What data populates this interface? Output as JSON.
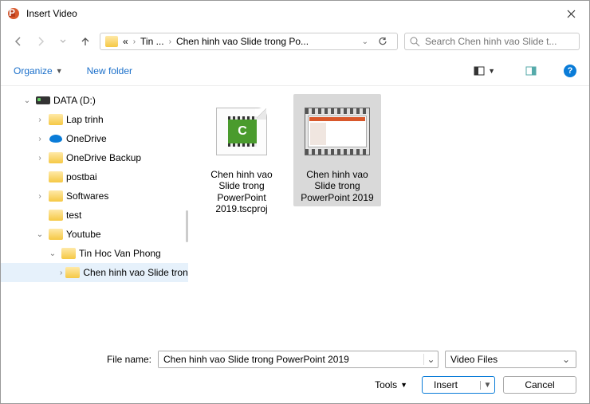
{
  "window": {
    "title": "Insert Video"
  },
  "breadcrumb": {
    "ell": "«",
    "seg1": "Tin ...",
    "seg2": "Chen hinh vao Slide trong Po..."
  },
  "search": {
    "placeholder": "Search Chen hinh vao Slide t..."
  },
  "toolbar": {
    "organize": "Organize",
    "newfolder": "New folder"
  },
  "tree": {
    "drive": "DATA (D:)",
    "laptrinh": "Lap trinh",
    "onedrive": "OneDrive",
    "onedrivebk": "OneDrive Backup",
    "postbai": "postbai",
    "softwares": "Softwares",
    "test": "test",
    "youtube": "Youtube",
    "tinhoc": "Tin Hoc Van Phong",
    "chen": "Chen hinh vao Slide tron"
  },
  "files": {
    "f1": "Chen hinh vao Slide trong PowerPoint 2019.tscproj",
    "f2": "Chen hinh vao Slide trong PowerPoint 2019"
  },
  "filename": {
    "label": "File name:",
    "value": "Chen hinh vao Slide trong PowerPoint 2019"
  },
  "filter": {
    "label": "Video Files"
  },
  "buttons": {
    "tools": "Tools",
    "insert": "Insert",
    "cancel": "Cancel"
  }
}
